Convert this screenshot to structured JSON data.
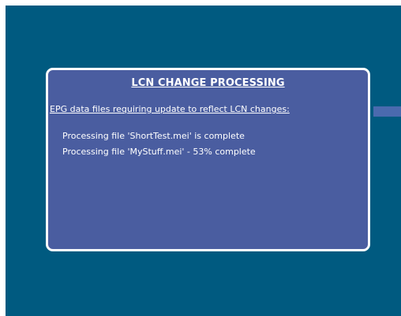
{
  "dialog": {
    "title": "LCN CHANGE PROCESSING",
    "subtitle": "EPG data files requiring update to reflect LCN changes:",
    "items": [
      {
        "text": "Processing file 'ShortTest.mei' is complete"
      },
      {
        "text": "Processing file 'MyStuff.mei' - 53% complete"
      }
    ]
  },
  "colors": {
    "screen_background": "#005a80",
    "dialog_background": "#4a5da0",
    "dialog_border": "#ffffff",
    "side_tab": "#4a6aae",
    "text": "#ffffff"
  }
}
